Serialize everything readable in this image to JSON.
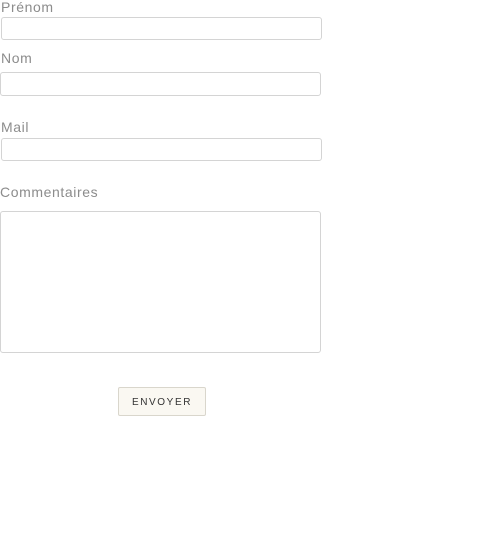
{
  "form": {
    "fields": {
      "prenom": {
        "label": "Prénom",
        "value": "",
        "placeholder": ""
      },
      "nom": {
        "label": "Nom",
        "value": "",
        "placeholder": ""
      },
      "mail": {
        "label": "Mail",
        "value": "",
        "placeholder": ""
      },
      "commentaires": {
        "label": "Commentaires",
        "value": "",
        "placeholder": ""
      }
    },
    "submit_label": "ENVOYER"
  }
}
